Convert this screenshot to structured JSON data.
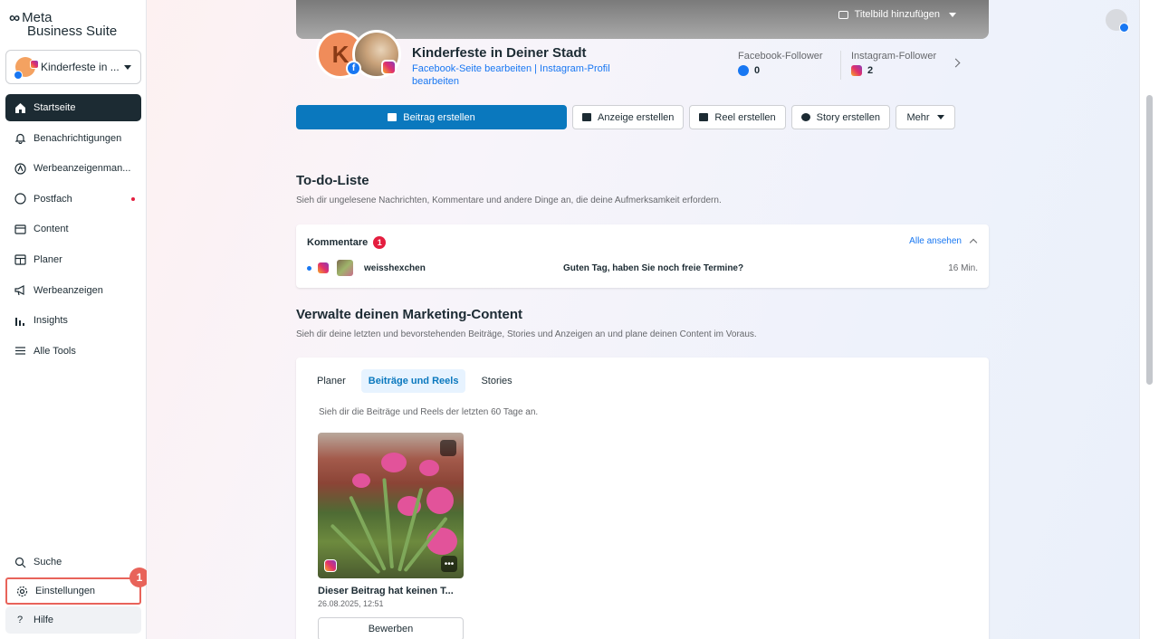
{
  "brand": {
    "line1": "Meta",
    "line2": "Business Suite"
  },
  "page_selector": {
    "name": "Kinderfeste in ..."
  },
  "nav": [
    {
      "label": "Startseite",
      "icon": "home-icon"
    },
    {
      "label": "Benachrichtigungen",
      "icon": "bell-icon"
    },
    {
      "label": "Werbeanzeigenman...",
      "icon": "ads-manager-icon"
    },
    {
      "label": "Postfach",
      "icon": "chat-icon"
    },
    {
      "label": "Content",
      "icon": "content-icon"
    },
    {
      "label": "Planer",
      "icon": "calendar-icon"
    },
    {
      "label": "Werbeanzeigen",
      "icon": "megaphone-icon"
    },
    {
      "label": "Insights",
      "icon": "insights-icon"
    },
    {
      "label": "Alle Tools",
      "icon": "menu-icon"
    }
  ],
  "bottom_nav": {
    "search": "Suche",
    "settings": "Einstellungen",
    "help": "Hilfe"
  },
  "callout": "1",
  "cover": {
    "button": "Titelbild hinzufügen"
  },
  "page": {
    "avatar_letter": "K",
    "title": "Kinderfeste in Deiner Stadt",
    "links": "Facebook-Seite bearbeiten | Instagram-Profil bearbeiten",
    "fb_label": "Facebook-Follower",
    "fb_value": "0",
    "ig_label": "Instagram-Follower",
    "ig_value": "2"
  },
  "actions": {
    "post": "Beitrag erstellen",
    "ad": "Anzeige erstellen",
    "reel": "Reel erstellen",
    "story": "Story erstellen",
    "more": "Mehr"
  },
  "todo": {
    "title": "To-do-Liste",
    "subtitle": "Sieh dir ungelesene Nachrichten, Kommentare und andere Dinge an, die deine Aufmerksamkeit erfordern.",
    "comments_label": "Kommentare",
    "comments_count": "1",
    "see_all": "Alle ansehen",
    "item": {
      "user": "weisshexchen",
      "message": "Guten Tag, haben Sie noch freie Termine?",
      "time": "16 Min."
    }
  },
  "marketing": {
    "title": "Verwalte deinen Marketing-Content",
    "subtitle": "Sieh dir deine letzten und bevorstehenden Beiträge, Stories und Anzeigen an und plane deinen Content im Voraus.",
    "tabs": [
      "Planer",
      "Beiträge und Reels",
      "Stories"
    ],
    "tab_subtitle": "Sieh dir die Beiträge und Reels der letzten 60 Tage an.",
    "post": {
      "title": "Dieser Beitrag hat keinen T...",
      "date": "26.08.2025, 12:51",
      "button": "Bewerben"
    }
  },
  "colors": {
    "primary": "#0a78be",
    "link": "#1877f2",
    "alert": "#e41e3f",
    "callout": "#e8635a"
  }
}
